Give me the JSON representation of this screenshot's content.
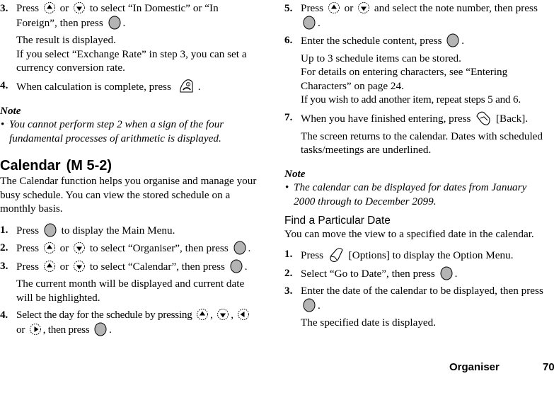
{
  "left": {
    "cont_steps": [
      {
        "num": "3.",
        "pre": "Press",
        "or": "or",
        "post": "to select “In Domestic” or “In Foreign”, then press",
        "end": "."
      },
      {
        "num": "4.",
        "pre": "When calculation is complete, press",
        "end": "."
      }
    ],
    "step3_sub1": "The result is displayed.",
    "step3_sub2": "If you select “Exchange Rate” in step 3, you can set a currency conversion rate.",
    "note_title": "Note",
    "note_text": "You cannot perform step 2 when a sign of the four fundamental processes of arithmetic is displayed.",
    "section_title": "Calendar",
    "section_menu": "(M 5-2)",
    "intro": "The Calendar function helps you organise and manage your busy schedule. You can view the stored schedule on a monthly basis.",
    "steps": [
      {
        "num": "1.",
        "pre": "Press",
        "post": "to display the Main Menu."
      },
      {
        "num": "2.",
        "pre": "Press",
        "or": "or",
        "post": "to select “Organiser”, then press",
        "end": "."
      },
      {
        "num": "3.",
        "pre": "Press",
        "or": "or",
        "post": "to select “Calendar”, then press",
        "end": ".",
        "sub": "The current month will be displayed and current date will be highlighted."
      },
      {
        "num": "4.",
        "pre": "Select the day for the schedule by pressing",
        "comma": ",",
        "or": "or",
        "post": ", then press",
        "end": "."
      }
    ]
  },
  "right": {
    "steps": [
      {
        "num": "5.",
        "pre": "Press",
        "or": "or",
        "post": "and select the note number, then press",
        "end": "."
      },
      {
        "num": "6.",
        "pre": "Enter the schedule content, press",
        "end": ".",
        "sub1": "Up to 3 schedule items can be stored.",
        "sub2": "For details on entering characters, see “Entering Characters” on page 24.",
        "sub3": "If you wish to add another item, repeat steps 5 and 6."
      },
      {
        "num": "7.",
        "pre": "When you have finished entering, press",
        "post": "[Back].",
        "sub": "The screen returns to the calendar. Dates with scheduled tasks/meetings are underlined."
      }
    ],
    "note_title": "Note",
    "note_text": "The calendar can be displayed for dates from January 2000 through to December 2099.",
    "subsection_title": "Find a Particular Date",
    "subsection_intro": "You can move the view to a specified date in the calendar.",
    "find_steps": [
      {
        "num": "1.",
        "pre": "Press",
        "post": "[Options] to display the Option Menu."
      },
      {
        "num": "2.",
        "pre": "Select “Go to Date”, then press",
        "end": "."
      },
      {
        "num": "3.",
        "pre": "Enter the date of the calendar to be displayed, then press",
        "end": ".",
        "sub": "The specified date is displayed."
      }
    ]
  },
  "footer": {
    "section": "Organiser",
    "page": "70"
  },
  "icons": {
    "up": "up-key-icon",
    "down": "down-key-icon",
    "left": "left-key-icon",
    "right": "right-key-icon",
    "center": "center-key-icon",
    "end": "end-key-icon",
    "soft_right": "right-soft-key-icon",
    "soft_left": "left-soft-key-icon"
  }
}
